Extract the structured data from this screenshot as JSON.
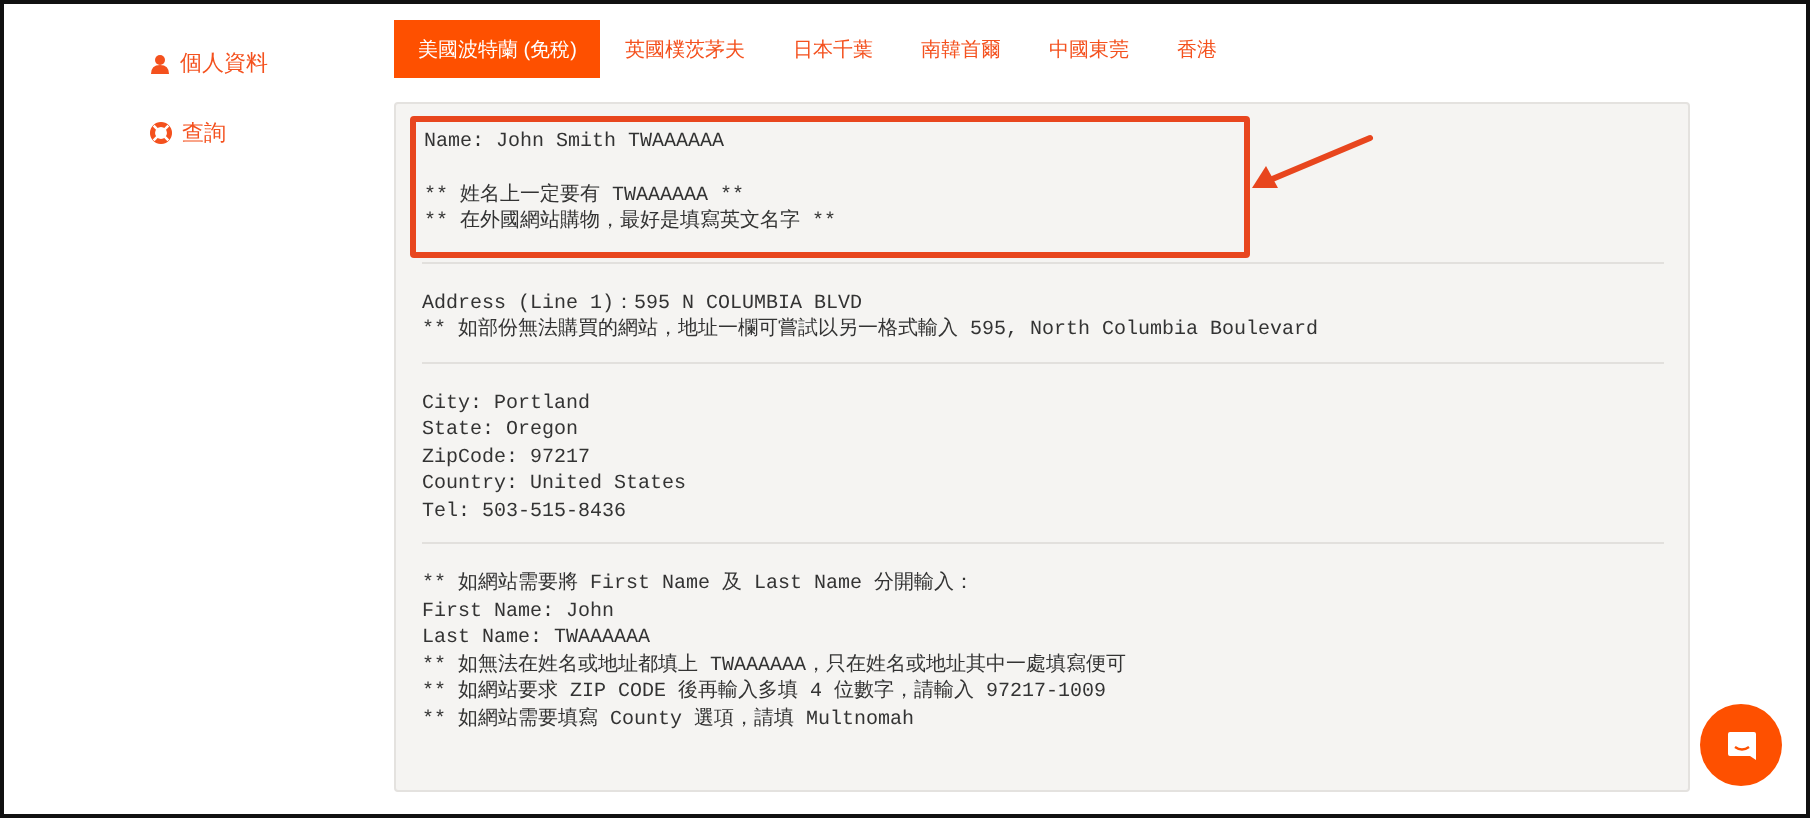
{
  "sidebar": {
    "items": [
      {
        "kind": "person",
        "label": "個人資料"
      },
      {
        "kind": "lifebuoy",
        "label": "查詢"
      }
    ]
  },
  "tabs": [
    {
      "label": "美國波特蘭 (免稅)",
      "selected": true
    },
    {
      "label": "英國樸茨茅夫",
      "selected": false
    },
    {
      "label": "日本千葉",
      "selected": false
    },
    {
      "label": "南韓首爾",
      "selected": false
    },
    {
      "label": "中國東莞",
      "selected": false
    },
    {
      "label": "香港",
      "selected": false
    }
  ],
  "sections": [
    {
      "highlighted": true,
      "paragraphs": [
        [
          "Name: John Smith TWAAAAAA"
        ],
        [
          "** 姓名上一定要有 TWAAAAAA **",
          "** 在外國網站購物，最好是填寫英文名字 **"
        ]
      ]
    },
    {
      "highlighted": false,
      "paragraphs": [
        [
          "Address (Line 1)：595 N COLUMBIA BLVD",
          "** 如部份無法購買的網站，地址一欄可嘗試以另一格式輸入 595, North Columbia Boulevard"
        ]
      ]
    },
    {
      "highlighted": false,
      "paragraphs": [
        [
          "City: Portland",
          "State: Oregon",
          "ZipCode: 97217",
          "Country: United States",
          "Tel: 503-515-8436"
        ]
      ]
    },
    {
      "highlighted": false,
      "paragraphs": [
        [
          "** 如網站需要將 First Name 及 Last Name 分開輸入：",
          "First Name: John",
          "Last Name: TWAAAAAA",
          "** 如無法在姓名或地址都填上 TWAAAAAA，只在姓名或地址其中一處填寫便可",
          "** 如網站要求 ZIP CODE 後再輸入多填 4 位數字，請輸入 97217-1009",
          "** 如網站需要填寫 County 選項，請填 Multnomah"
        ]
      ]
    }
  ]
}
